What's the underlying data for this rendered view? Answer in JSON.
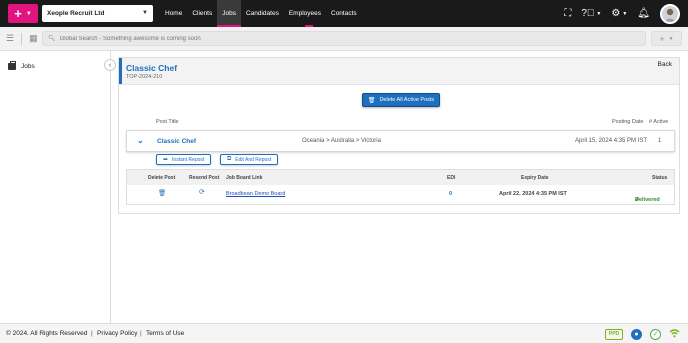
{
  "topbar": {
    "add_icon": "plus-icon",
    "company": "Xeople Recruit Ltd",
    "nav": [
      "Home",
      "Clients",
      "Jobs",
      "Candidates",
      "Employees",
      "Contacts"
    ],
    "active_nav": "Jobs",
    "accent_color": "#e2147f"
  },
  "search": {
    "placeholder": "Global Search - Something awesome is coming soon"
  },
  "sidebar": {
    "items": [
      {
        "label": "Jobs",
        "icon": "briefcase-icon"
      }
    ]
  },
  "card": {
    "title": "Classic Chef",
    "code": "TOP-2024-210",
    "back_label": "Back",
    "delete_all_label": "Delete All Active Posts",
    "columns": {
      "post_title": "Post Title",
      "posting_date": "Posting Date",
      "active": "# Active"
    },
    "post": {
      "title": "Classic Chef",
      "location": "Oceania > Australia > Victoria",
      "date": "April 15, 2024 4:35 PM IST",
      "active_count": "1",
      "instant_repost_label": "Instant Repost",
      "edit_repost_label": "Edit And Repost"
    },
    "sub_table": {
      "headers": [
        "Delete Post",
        "Resend Post",
        "Job Board Link",
        "EDI",
        "Expiry Date",
        "Status"
      ],
      "row": {
        "board_link": "Broadbean Demo Board",
        "edi": "0",
        "expiry": "April 22, 2024 4:35 PM IST",
        "status": "Delivered"
      }
    }
  },
  "footer": {
    "copyright": "© 2024. All Rights Reserved",
    "privacy": "Privacy Policy",
    "terms": "Terms of Use",
    "ppd": "PPD"
  },
  "colors": {
    "brand_blue": "#1f6fbf",
    "success": "#2e8b2e",
    "accent": "#e2147f"
  }
}
